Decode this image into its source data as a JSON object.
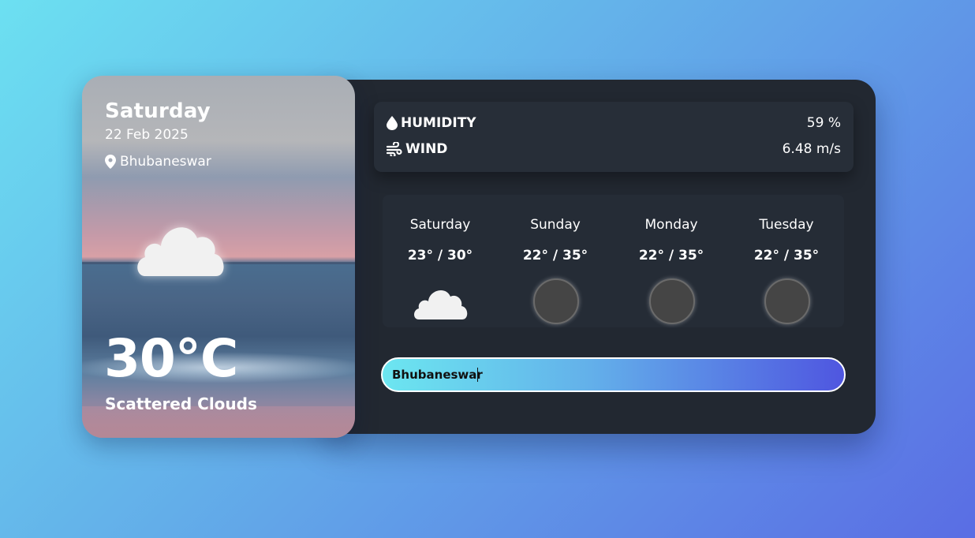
{
  "current": {
    "day": "Saturday",
    "date": "22 Feb 2025",
    "location": "Bhubaneswar",
    "temperature": "30°C",
    "condition": "Scattered Clouds",
    "icon": "cloud-icon"
  },
  "stats": {
    "humidity_label": "HUMIDITY",
    "humidity_value": "59 %",
    "wind_label": "WIND",
    "wind_value": "6.48 m/s"
  },
  "forecast": [
    {
      "day": "Saturday",
      "temp": "23° / 30°",
      "icon": "cloud-icon"
    },
    {
      "day": "Sunday",
      "temp": "22° / 35°",
      "icon": "placeholder-icon"
    },
    {
      "day": "Monday",
      "temp": "22° / 35°",
      "icon": "placeholder-icon"
    },
    {
      "day": "Tuesday",
      "temp": "22° / 35°",
      "icon": "placeholder-icon"
    }
  ],
  "search": {
    "value": "Bhubaneswar"
  },
  "colors": {
    "panel_bg": "#222831",
    "accent_start": "#6ce6f0",
    "accent_end": "#4f56e0"
  }
}
